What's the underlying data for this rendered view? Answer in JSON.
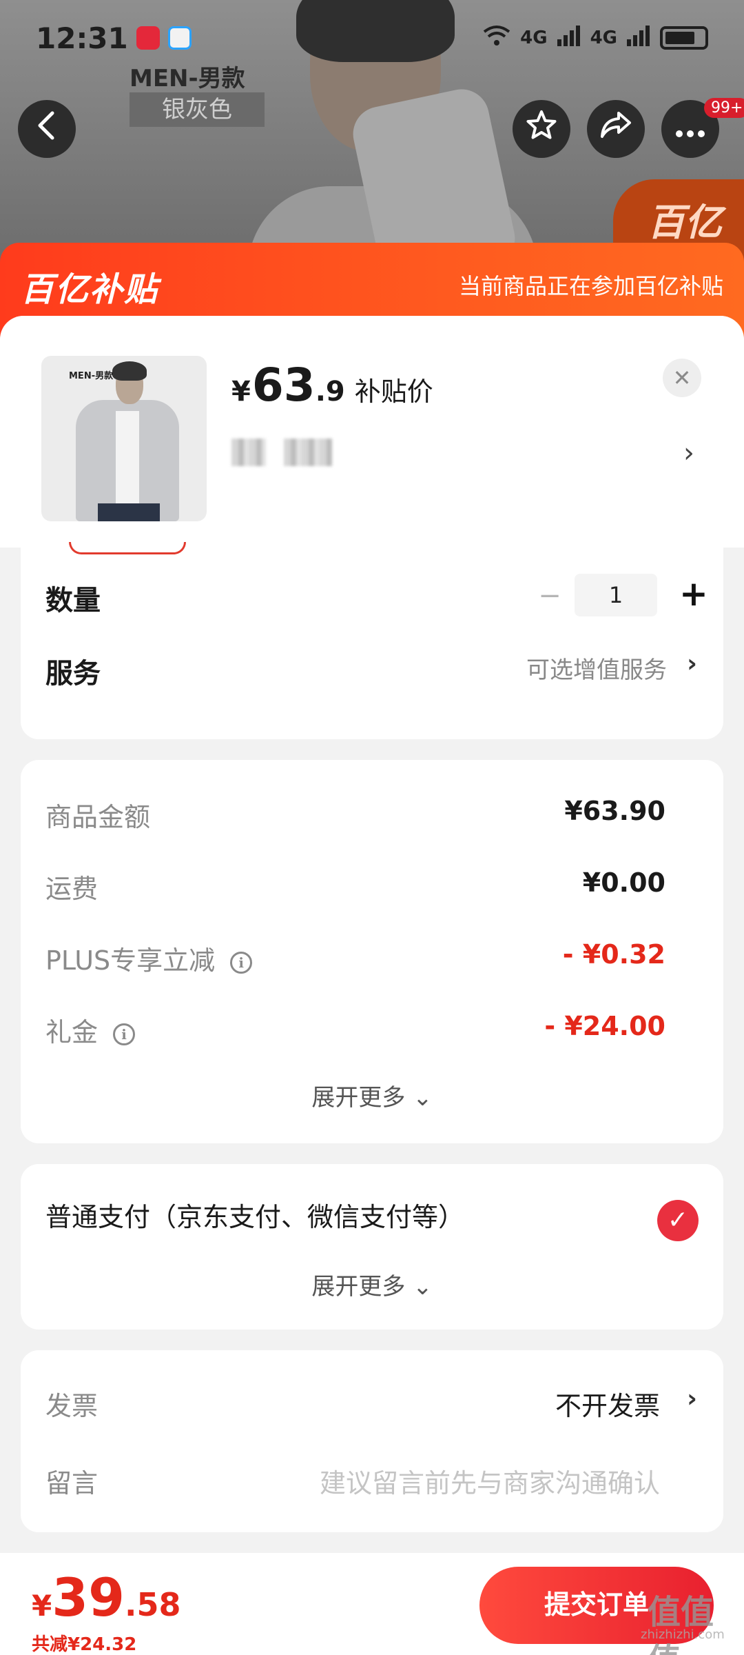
{
  "status_bar": {
    "time": "12:31",
    "signal_1": "4G",
    "signal_2": "4G"
  },
  "background": {
    "label": "MEN-男款",
    "sublabel": "银灰色",
    "badge": "99+",
    "subsidy_tag": "百亿"
  },
  "banner": {
    "logo": "百亿补贴",
    "text": "当前商品正在参加百亿补贴"
  },
  "product": {
    "image_label": "MEN-男款",
    "currency": "¥",
    "price_int": "63",
    "price_dec": ".9",
    "price_label": "补贴价"
  },
  "quantity": {
    "label": "数量",
    "value": "1",
    "minus": "−",
    "plus": "+"
  },
  "service": {
    "label": "服务",
    "value": "可选增值服务"
  },
  "price_lines": [
    {
      "label": "商品金额",
      "value": "¥63.90"
    },
    {
      "label": "运费",
      "value": "¥0.00"
    },
    {
      "label": "PLUS专享立减",
      "value": "- ¥0.32"
    },
    {
      "label": "礼金",
      "value": "- ¥24.00"
    }
  ],
  "expand_more": "展开更多 ⌄",
  "payment": {
    "label": "普通支付（京东支付、微信支付等）",
    "expand_more": "展开更多 ⌄"
  },
  "invoice": {
    "label": "发票",
    "value": "不开发票"
  },
  "note": {
    "label": "留言",
    "placeholder": "建议留言前先与商家沟通确认"
  },
  "footer": {
    "currency": "¥",
    "total_int": "39",
    "total_dec": ".58",
    "savings": "共减¥24.32",
    "submit": "提交订单"
  },
  "watermark": {
    "main": "值值值",
    "sub": "zhizhizhi.com"
  },
  "colors": {
    "accent_red": "#e4281a",
    "banner_orange": "#ff4a1c",
    "button_red": "#e8202f"
  }
}
